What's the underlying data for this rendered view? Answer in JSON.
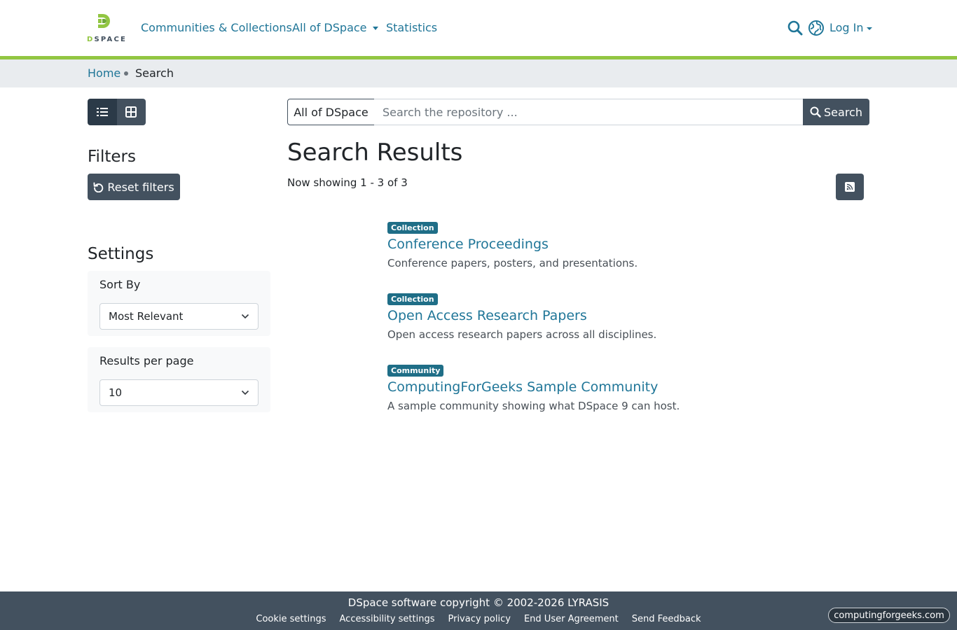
{
  "header": {
    "logo_text_first": "D",
    "logo_text_rest": "SPACE",
    "nav": {
      "communities": "Communities & Collections",
      "all_of_dspace": "All of DSpace",
      "statistics": "Statistics"
    },
    "login": "Log In",
    "accent_color": "#92c642"
  },
  "breadcrumb": {
    "home": "Home",
    "current": "Search"
  },
  "search": {
    "scope": "All of DSpace",
    "placeholder": "Search the repository ...",
    "button": "Search"
  },
  "sidebar": {
    "filters_heading": "Filters",
    "reset_label": "Reset filters",
    "settings_heading": "Settings",
    "sort_label": "Sort By",
    "sort_value": "Most Relevant",
    "rpp_label": "Results per page",
    "rpp_value": "10"
  },
  "main": {
    "title": "Search Results",
    "count": "Now showing 1 - 3 of 3",
    "results": [
      {
        "type": "Collection",
        "title": "Conference Proceedings",
        "description": "Conference papers, posters, and presentations."
      },
      {
        "type": "Collection",
        "title": "Open Access Research Papers",
        "description": "Open access research papers across all disciplines."
      },
      {
        "type": "Community",
        "title": "ComputingForGeeks Sample Community",
        "description": "A sample community showing what DSpace 9 can host."
      }
    ]
  },
  "footer": {
    "copyright": "DSpace software copyright © 2002-2026 LYRASIS",
    "links": [
      "Cookie settings",
      "Accessibility settings",
      "Privacy policy",
      "End User Agreement",
      "Send Feedback"
    ]
  },
  "watermark": "computingforgeeks.com",
  "colors": {
    "primary": "#43515f",
    "link": "#207698",
    "badge": "#1f6e87"
  }
}
